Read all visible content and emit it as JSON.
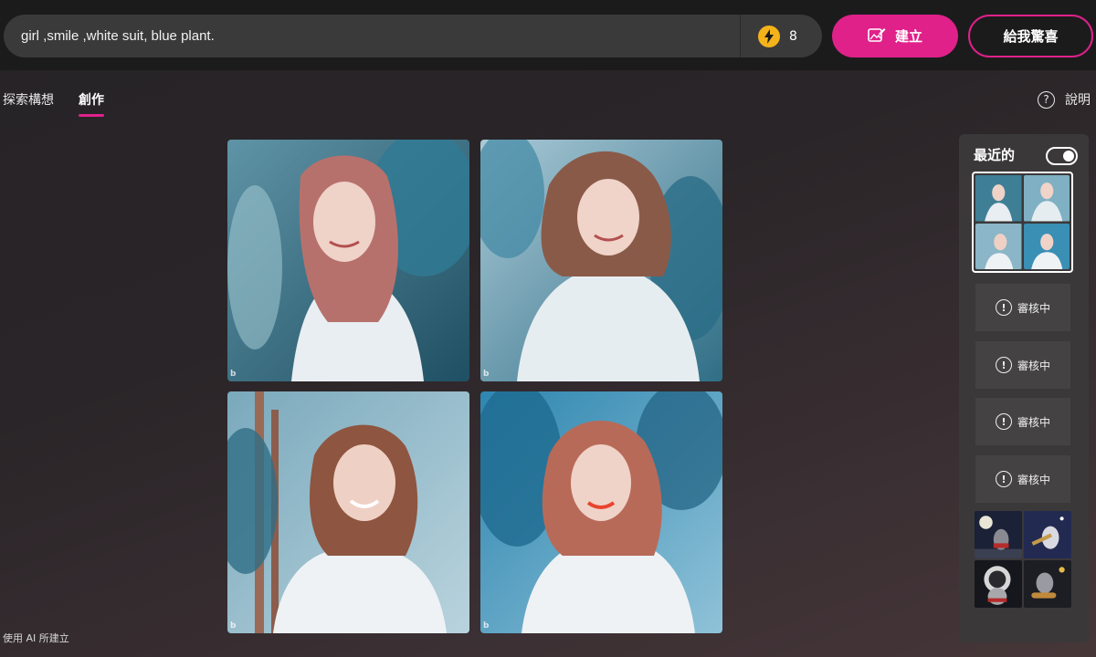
{
  "prompt": {
    "value": "girl ,smile ,white suit, blue plant."
  },
  "boosts": {
    "count": "8",
    "icon": "lightning-icon"
  },
  "buttons": {
    "create_label": "建立",
    "surprise_label": "給我驚喜"
  },
  "tabs": [
    {
      "label": "探索構想",
      "active": false
    },
    {
      "label": "創作",
      "active": true
    }
  ],
  "help": {
    "label": "說明"
  },
  "watermark": "b",
  "recent": {
    "title": "最近的",
    "toggle_on": true,
    "pending": [
      {
        "label": "審核中"
      },
      {
        "label": "審核中"
      },
      {
        "label": "審核中"
      },
      {
        "label": "審核中"
      }
    ]
  },
  "footer": {
    "note": "使用 AI 所建立"
  },
  "colors": {
    "accent": "#e0218a",
    "boost": "#f4b31a",
    "panel": "#3a3839",
    "topbar": "#1c1b1c"
  }
}
